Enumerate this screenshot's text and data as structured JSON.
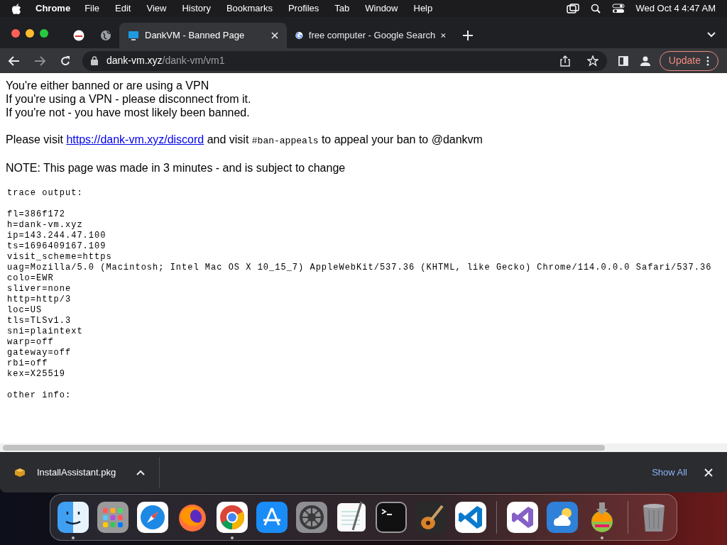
{
  "menu_bar": {
    "app": "Chrome",
    "items": [
      "File",
      "Edit",
      "View",
      "History",
      "Bookmarks",
      "Profiles",
      "Tab",
      "Window",
      "Help"
    ],
    "clock": "Wed Oct 4  4:47 AM"
  },
  "tabs": [
    {
      "kind": "pinned",
      "selected": false
    },
    {
      "kind": "pinned",
      "selected": false
    },
    {
      "kind": "page",
      "title": "DankVM - Banned Page",
      "selected": true
    },
    {
      "kind": "page",
      "title": "free computer - Google Search",
      "selected": false
    }
  ],
  "address_bar": {
    "domain": "dank-vm.xyz",
    "path": "/dank-vm/vm1"
  },
  "update_button": "Update",
  "page": {
    "intro": [
      "You're either banned or are using a VPN",
      "If you're using a VPN - please disconnect from it.",
      "If you're not - you have most likely been banned."
    ],
    "appeal": [
      {
        "kind": "text",
        "text": "Please visit "
      },
      {
        "kind": "link",
        "text": "https://dank-vm.xyz/discord"
      },
      {
        "kind": "text",
        "text": " and visit "
      },
      {
        "kind": "code",
        "text": "#ban-appeals"
      },
      {
        "kind": "text",
        "text": " to appeal your ban to @dankvm"
      }
    ],
    "note": "NOTE: This page was made in 3 minutes - and is subject to change",
    "trace_heading": "trace output:",
    "trace_lines": [
      "fl=386f172",
      "h=dank-vm.xyz",
      "ip=143.244.47.100",
      "ts=1696409167.109",
      "visit_scheme=https",
      "uag=Mozilla/5.0 (Macintosh; Intel Mac OS X 10_15_7) AppleWebKit/537.36 (KHTML, like Gecko) Chrome/114.0.0.0 Safari/537.36",
      "colo=EWR",
      "sliver=none",
      "http=http/3",
      "loc=US",
      "tls=TLSv1.3",
      "sni=plaintext",
      "warp=off",
      "gateway=off",
      "rbi=off",
      "kex=X25519"
    ],
    "other_heading": "other info:"
  },
  "download_bar": {
    "file": "InstallAssistant.pkg",
    "show_all": "Show All"
  },
  "dock": [
    {
      "kind": "finder",
      "running": true
    },
    {
      "kind": "launchpad",
      "running": false
    },
    {
      "kind": "safari",
      "running": false
    },
    {
      "kind": "firefox",
      "running": false
    },
    {
      "kind": "chrome",
      "running": true
    },
    {
      "kind": "appstore",
      "running": false
    },
    {
      "kind": "settings",
      "running": false
    },
    {
      "kind": "textedit",
      "running": false
    },
    {
      "kind": "terminal",
      "running": false
    },
    {
      "kind": "garageband",
      "running": false
    },
    {
      "kind": "vscode",
      "running": false
    },
    {
      "kind": "separator"
    },
    {
      "kind": "visualstudio",
      "running": false
    },
    {
      "kind": "weather",
      "running": false
    },
    {
      "kind": "installer",
      "running": true
    },
    {
      "kind": "separator"
    },
    {
      "kind": "trash",
      "running": false
    }
  ]
}
